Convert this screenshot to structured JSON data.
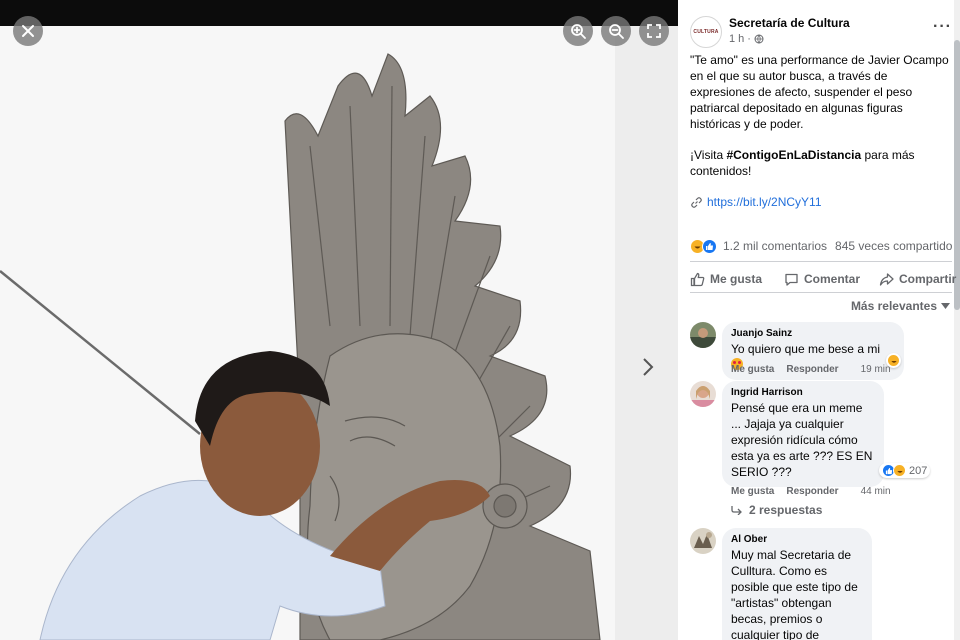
{
  "viewer": {
    "photo_alt": "Photo",
    "icons": {
      "close": "close-icon",
      "zoom_in": "zoom-in-icon",
      "zoom_out": "zoom-out-icon",
      "fullscreen": "fullscreen-icon",
      "next": "chevron-right-icon"
    }
  },
  "post": {
    "page_name": "Secretaría de Cultura",
    "avatar_text": "CULTURA",
    "time": "1 h",
    "audience_icon": "globe-icon",
    "paragraph1": "\"Te amo\" es una performance de Javier Ocampo en el que su autor busca, a través de expresiones de afecto, suspender el peso patriarcal depositado en algunas figuras históricas y de poder.",
    "paragraph2_before": "¡Visita ",
    "hashtag": "#ContigoEnLaDistancia",
    "paragraph2_after": " para más contenidos!",
    "link": "https://bit.ly/2NCyY11",
    "comments_count": "1.2 mil comentarios",
    "shares_count": "845 veces compartido",
    "actions": {
      "like": "Me gusta",
      "comment": "Comentar",
      "share": "Compartir"
    },
    "sort_label": "Más relevantes"
  },
  "comments": [
    {
      "author": "Juanjo Sainz",
      "text": "Yo quiero que me bese a mi",
      "like": "Me gusta",
      "reply": "Responder",
      "time": "19 min"
    },
    {
      "author": "Ingrid Harrison",
      "text": "Pensé que era un meme ... Jajaja ya cualquier expresión ridícula cómo esta ya es arte ??? ES EN SERIO ???",
      "reactions_count": "207",
      "like": "Me gusta",
      "reply": "Responder",
      "time": "44 min",
      "replies": "2 respuestas"
    },
    {
      "author": "Al Ober",
      "text": "Muy mal Secretaria de Culltura. Como es posible que este tipo de \"artistas\" obtengan becas, premios o cualquier tipo de"
    }
  ],
  "colors": {
    "link": "#216fdb",
    "like_blue": "#1877f2",
    "haha_yellow": "#f7b125",
    "bubble": "#f0f2f5",
    "muted": "#65676b"
  }
}
